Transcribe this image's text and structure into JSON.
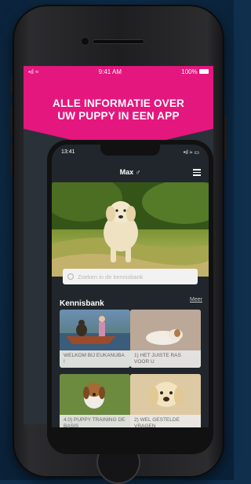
{
  "status_bar": {
    "signal": "•ıl ≈",
    "time": "9:41 AM",
    "battery": "100%"
  },
  "banner": {
    "line1": "ALLE INFORMATIE OVER",
    "line2": "UW PUPPY IN EEN APP",
    "color": "#e4177e"
  },
  "app": {
    "status_time": "13:41",
    "status_icons": "•ıl ≈ ▭",
    "nav_title": "Max ♂",
    "search_placeholder": "Zoeken in de kennisbank",
    "section_title": "Kennisbank",
    "section_more": "Meer",
    "cards": [
      {
        "label": "WELKOM BIJ EUKANUBA !",
        "icon": "dog-on-boat"
      },
      {
        "label": "1) HET JUISTE RAS VOOR U",
        "icon": "sleeping-puppy"
      },
      {
        "label": "4.0) PUPPY TRAINING DE BASIS",
        "icon": "beagle-puppy"
      },
      {
        "label": "2) WEL GESTELDE VRAGEN",
        "icon": "labrador-puppy"
      }
    ]
  }
}
